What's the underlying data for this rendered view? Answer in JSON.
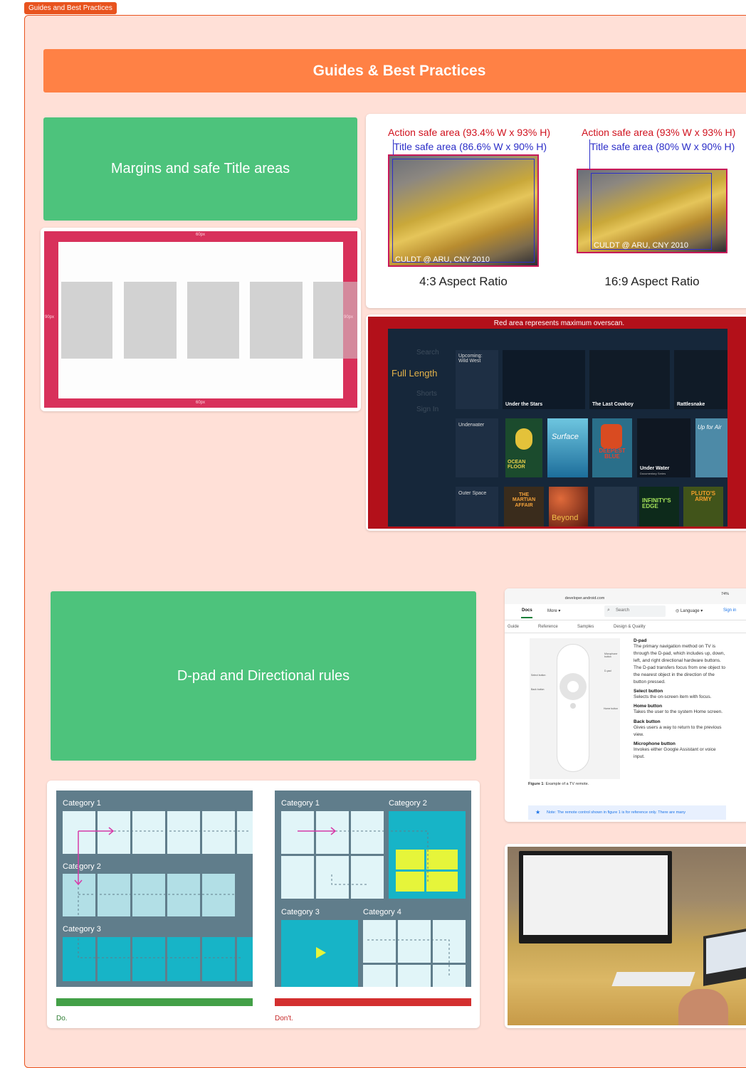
{
  "frame": {
    "tag": "Guides and Best Practices"
  },
  "banner": {
    "title": "Guides & Best Practices"
  },
  "margins": {
    "card_title": "Margins and safe Title areas",
    "top_px": "60px",
    "bottom_px": "60px",
    "left_px": "90px",
    "right_px": "90px"
  },
  "safe_areas": {
    "left": {
      "action": "Action safe area (93.4% W x 93% H)",
      "title": "Title safe area (86.6% W x 90% H)",
      "watermark": "CULDT @ ARU, CNY 2010",
      "ratio": "4:3 Aspect Ratio"
    },
    "right": {
      "action": "Action safe area (93% W x 93% H)",
      "title": "Title safe area (80% W x 90% H)",
      "watermark": "CULDT @ ARU, CNY 2010",
      "ratio": "16:9 Aspect Ratio"
    }
  },
  "overscan": {
    "caption": "Red area represents maximum overscan.",
    "menu": [
      "Search",
      "Full Length",
      "Shorts",
      "Sign In"
    ],
    "rows": [
      {
        "label": "Upcoming:\nWild West",
        "titles": [
          "Under the Stars",
          "The Last Cowboy",
          "Rattlesnake"
        ]
      },
      {
        "label": "Underwater",
        "titles": [
          "Surface",
          "DEEPEST BLUE",
          "Under Water",
          "OCEAN FLOOR",
          "Up for Air"
        ]
      },
      {
        "label": "Outer Space",
        "titles": [
          "THE MARTIAN AFFAIR",
          "Beyond",
          "INFINITY'S EDGE",
          "PLUTO'S ARMY"
        ]
      }
    ],
    "sub_under_water": "Documentary Series"
  },
  "dpad": {
    "card_title": "D-pad and Directional rules",
    "do_label": "Do.",
    "dont_label": "Don't.",
    "do_categories": [
      "Category 1",
      "Category 2",
      "Category 3"
    ],
    "dont_categories": [
      "Category 1",
      "Category 2",
      "Category 3",
      "Category 4"
    ]
  },
  "docs": {
    "url": "developer.android.com",
    "battery": "74%",
    "nav": [
      "Docs",
      "More ▾"
    ],
    "search": "Search",
    "language": "Language ▾",
    "signin": "Sign in",
    "subnav": [
      "Guide",
      "Reference",
      "Samples",
      "Design & Quality"
    ],
    "remote_labels": [
      "Microphone button",
      "D-pad",
      "Select button",
      "Back button",
      "Home button"
    ],
    "figure_caption_bold": "Figure 1",
    "figure_caption": ": Example of a TV remote.",
    "sections": [
      {
        "h": "D-pad",
        "t": "The primary navigation method on TV is through the D-pad, which includes up, down, left, and right directional hardware buttons. The D-pad transfers focus from one object to the nearest object in the direction of the button pressed."
      },
      {
        "h": "Select button",
        "t": "Selects the on-screen item with focus."
      },
      {
        "h": "Home button",
        "t": "Takes the user to the system Home screen."
      },
      {
        "h": "Back button",
        "t": "Gives users a way to return to the previous view."
      },
      {
        "h": "Microphone button",
        "t": "Invokes either Google Assistant or voice input."
      }
    ],
    "note": "Note: The remote control shown in figure 1 is for reference only. There are many"
  },
  "colors": {
    "section_bg": "#ffe0d7",
    "accent": "#e8531e",
    "banner": "#ff8145",
    "green": "#4dc37c",
    "tv_frame": "#d8315b",
    "do_bar": "#43a047",
    "dont_bar": "#d32f2f"
  }
}
